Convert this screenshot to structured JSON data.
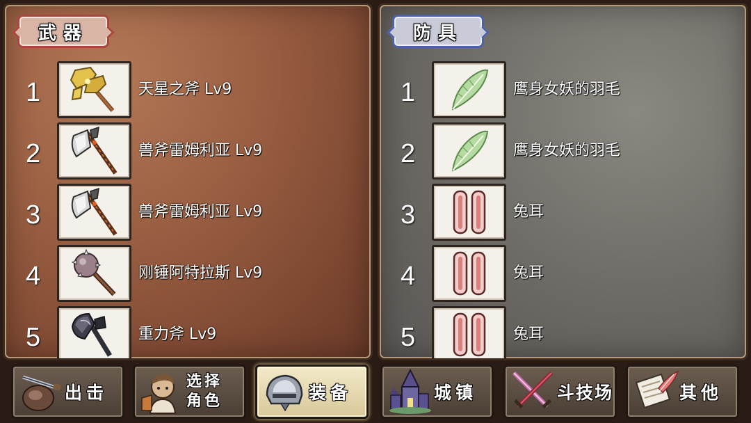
{
  "weapons": {
    "title": "武器",
    "items": [
      {
        "rank": "1",
        "name": "天星之斧 Lv9",
        "icon": "golden-axe-icon"
      },
      {
        "rank": "2",
        "name": "兽斧雷姆利亚 Lv9",
        "icon": "beast-axe-icon"
      },
      {
        "rank": "3",
        "name": "兽斧雷姆利亚 Lv9",
        "icon": "beast-axe-icon"
      },
      {
        "rank": "4",
        "name": "刚锤阿特拉斯 Lv9",
        "icon": "spiked-mace-icon"
      },
      {
        "rank": "5",
        "name": "重力斧 Lv9",
        "icon": "gravity-axe-icon"
      }
    ]
  },
  "armor": {
    "title": "防具",
    "items": [
      {
        "rank": "1",
        "name": "鹰身女妖的羽毛",
        "icon": "feather-icon"
      },
      {
        "rank": "2",
        "name": "鹰身女妖的羽毛",
        "icon": "feather-icon"
      },
      {
        "rank": "3",
        "name": "兔耳",
        "icon": "bunny-ears-icon"
      },
      {
        "rank": "4",
        "name": "兔耳",
        "icon": "bunny-ears-icon"
      },
      {
        "rank": "5",
        "name": "兔耳",
        "icon": "bunny-ears-icon"
      }
    ]
  },
  "nav": {
    "sortie": "出击",
    "select_line1": "选择",
    "select_line2": "角色",
    "equip": "装备",
    "town": "城镇",
    "arena": "斗技场",
    "other": "其他",
    "active": "equip"
  }
}
